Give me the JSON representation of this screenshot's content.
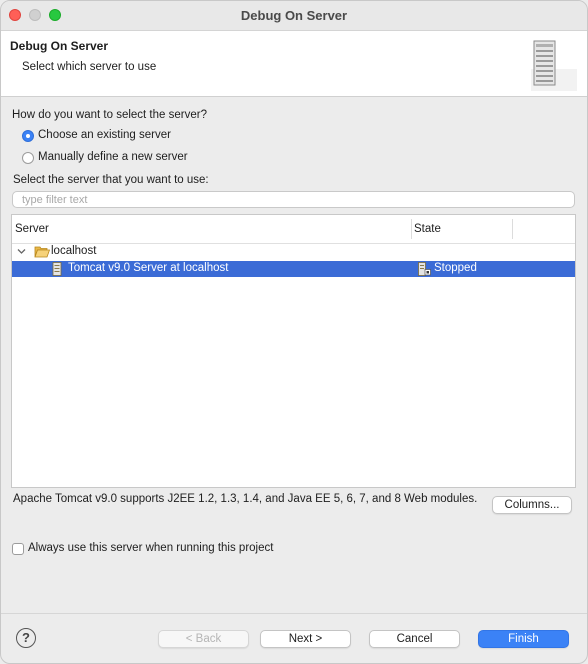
{
  "window": {
    "title": "Debug On Server"
  },
  "header": {
    "title": "Debug On Server",
    "description": "Select which server to use",
    "icon": "server-tower-icon"
  },
  "selection": {
    "question": "How do you want to select the server?",
    "options": [
      {
        "label": "Choose an existing server",
        "selected": true
      },
      {
        "label": "Manually define a new server",
        "selected": false
      }
    ]
  },
  "server_list": {
    "label": "Select the server that you want to use:",
    "filter_placeholder": "type filter text",
    "columns": [
      "Server",
      "State"
    ],
    "groups": [
      {
        "name": "localhost",
        "expanded": true,
        "icon": "folder-open-icon",
        "servers": [
          {
            "name": "Tomcat v9.0 Server at localhost",
            "state": "Stopped",
            "selected": true,
            "icon": "server-icon",
            "state_icon": "server-stopped-icon"
          }
        ]
      }
    ]
  },
  "server_description": "Apache Tomcat v9.0 supports J2EE 1.2, 1.3, 1.4, and Java EE 5, 6, 7, and 8 Web modules.",
  "columns_button": "Columns...",
  "always_use": {
    "label": "Always use this server when running this project",
    "checked": false
  },
  "footer": {
    "help_icon": "help-icon",
    "help_glyph": "?",
    "back": "< Back",
    "next": "Next >",
    "cancel": "Cancel",
    "finish": "Finish"
  },
  "colors": {
    "accent": "#3b82f6",
    "selection": "#3b6bd6"
  }
}
